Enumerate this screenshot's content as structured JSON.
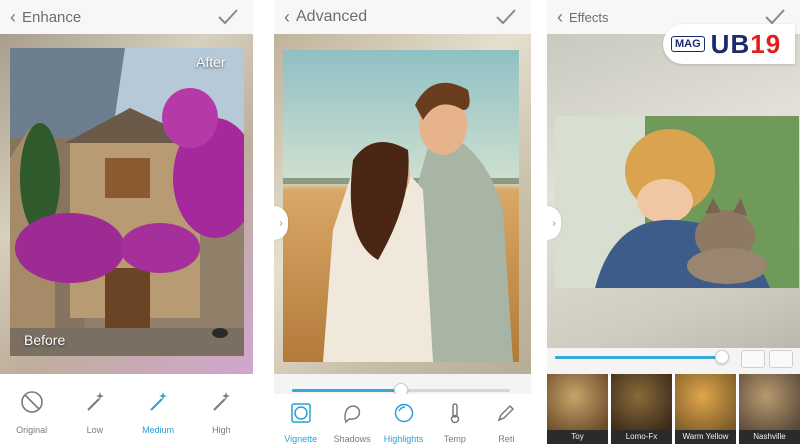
{
  "panels": [
    {
      "title": "Enhance",
      "photo_labels": {
        "before": "Before",
        "after": "After"
      },
      "tools": [
        {
          "label": "Original",
          "icon": "no-icon",
          "active": false
        },
        {
          "label": "Low",
          "icon": "magic-wand-icon",
          "active": false
        },
        {
          "label": "Medium",
          "icon": "magic-wand-icon",
          "active": true
        },
        {
          "label": "High",
          "icon": "magic-wand-icon",
          "active": false
        }
      ]
    },
    {
      "title": "Advanced",
      "slider_fraction": 0.5,
      "tools": [
        {
          "label": "Vignette",
          "icon": "vignette-icon",
          "active": true
        },
        {
          "label": "Shadows",
          "icon": "shadows-icon",
          "active": false
        },
        {
          "label": "Highlights",
          "icon": "highlights-icon",
          "active": true
        },
        {
          "label": "Temp",
          "icon": "thermometer-icon",
          "active": false
        },
        {
          "label": "Reti",
          "icon": "pen-icon",
          "active": false
        }
      ]
    },
    {
      "title": "Effects",
      "slider_fraction": 0.97,
      "thumbnails": [
        {
          "label": "Toy"
        },
        {
          "label": "Lomo-Fx"
        },
        {
          "label": "Warm Yellow"
        },
        {
          "label": "Nashville"
        }
      ]
    }
  ],
  "watermark": {
    "mag": "MAG",
    "brand_left": "UB",
    "brand_right": "19"
  },
  "colors": {
    "accent": "#2c9fd4",
    "logo_blue": "#1a2a6b",
    "logo_red": "#e0201b"
  }
}
